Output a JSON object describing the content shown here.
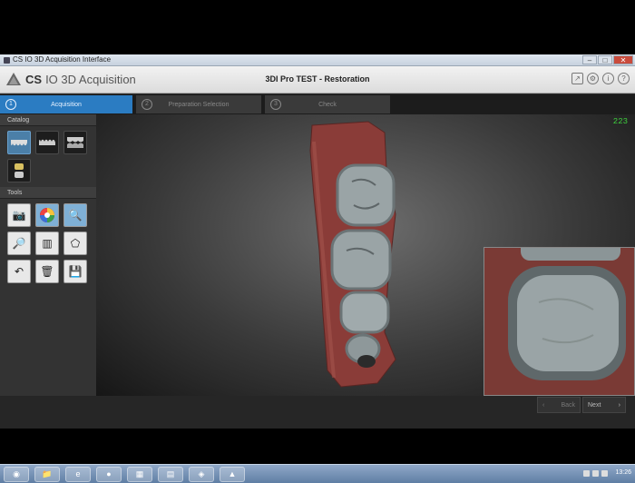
{
  "window": {
    "title": "CS IO 3D Acquisition Interface",
    "controls": [
      "minimize",
      "maximize",
      "close"
    ]
  },
  "header": {
    "logo_cs": "CS",
    "logo_rest": "IO 3D Acquisition",
    "document_title": "3DI Pro TEST - Restoration",
    "icons": [
      "export-icon",
      "settings-icon",
      "info-icon",
      "help-icon"
    ]
  },
  "steps": [
    {
      "num": "1",
      "label": "Acquisition",
      "active": true
    },
    {
      "num": "2",
      "label": "Preparation Selection",
      "active": false
    },
    {
      "num": "3",
      "label": "Check",
      "active": false
    }
  ],
  "sidebar": {
    "catalog_label": "Catalog",
    "tools_label": "Tools",
    "catalog_items": [
      "upper-jaw-icon",
      "lower-jaw-icon",
      "bite-icon",
      "occlusion-icon"
    ],
    "tool_items": [
      "camera-icon",
      "color-wheel-icon",
      "zoom-lock-icon",
      "zoom-icon",
      "trim-icon",
      "polygon-select-icon",
      "undo-icon",
      "delete-icon",
      "save-icon"
    ]
  },
  "viewport": {
    "frame_counter": "223",
    "counter_color": "#3ed03e"
  },
  "footer": {
    "back_label": "Back",
    "next_label": "Next"
  },
  "taskbar": {
    "time": "13:26"
  },
  "colors": {
    "accent": "#2b7cc2",
    "gum": "#8a3c38",
    "tooth": "#9aa4a6"
  }
}
